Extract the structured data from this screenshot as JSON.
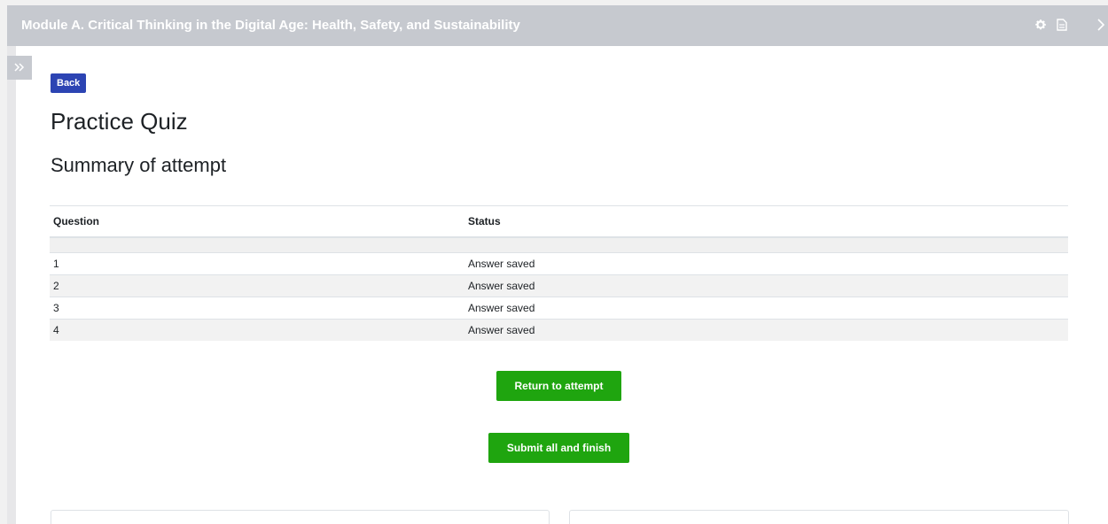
{
  "header": {
    "title": "Module A. Critical Thinking in the Digital Age: Health, Safety, and Sustainability",
    "icons": [
      "gear-icon",
      "document-icon",
      "close-chevron-icon"
    ]
  },
  "drawer": {
    "icon": "double-chevron-right-icon"
  },
  "back_label": "Back",
  "page_title": "Practice Quiz",
  "summary_title": "Summary of attempt",
  "table": {
    "headers": [
      "Question",
      "Status"
    ],
    "rows": [
      {
        "question": "1",
        "status": "Answer saved"
      },
      {
        "question": "2",
        "status": "Answer saved"
      },
      {
        "question": "3",
        "status": "Answer saved"
      },
      {
        "question": "4",
        "status": "Answer saved"
      }
    ]
  },
  "buttons": {
    "return_label": "Return to attempt",
    "submit_label": "Submit all and finish"
  },
  "colors": {
    "header_bg": "#c6c9cf",
    "back_button": "#2c44b3",
    "action_button": "#1fa50f"
  }
}
